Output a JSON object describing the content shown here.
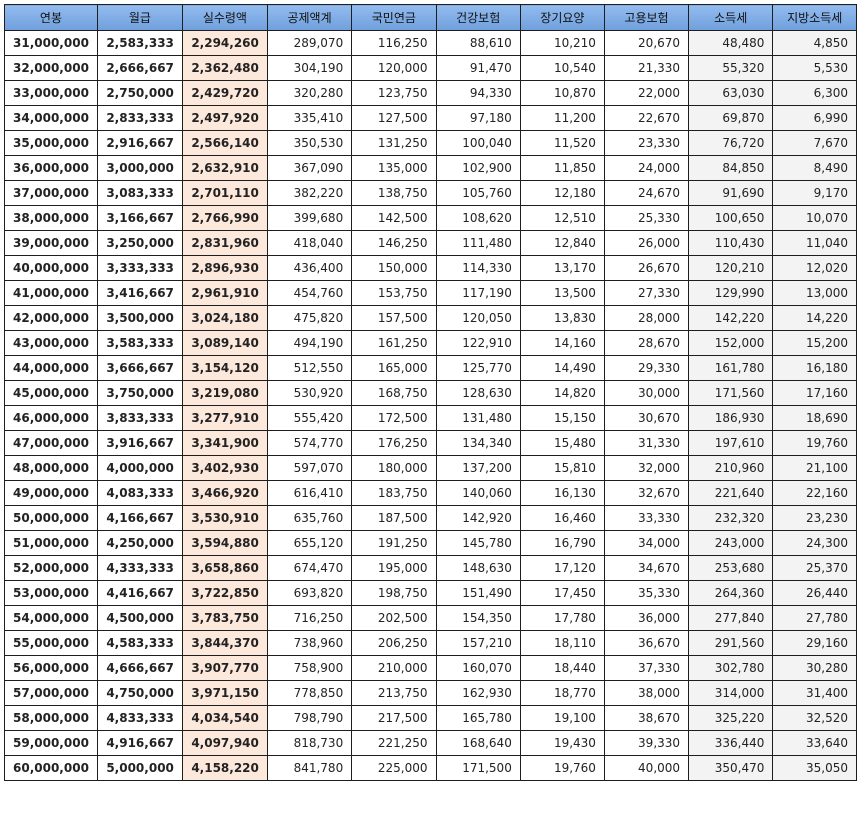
{
  "table": {
    "headers": [
      "연봉",
      "월급",
      "실수령액",
      "공제액계",
      "국민연금",
      "건강보험",
      "장기요양",
      "고용보험",
      "소득세",
      "지방소득세"
    ],
    "rows": [
      [
        "31,000,000",
        "2,583,333",
        "2,294,260",
        "289,070",
        "116,250",
        "88,610",
        "10,210",
        "20,670",
        "48,480",
        "4,850"
      ],
      [
        "32,000,000",
        "2,666,667",
        "2,362,480",
        "304,190",
        "120,000",
        "91,470",
        "10,540",
        "21,330",
        "55,320",
        "5,530"
      ],
      [
        "33,000,000",
        "2,750,000",
        "2,429,720",
        "320,280",
        "123,750",
        "94,330",
        "10,870",
        "22,000",
        "63,030",
        "6,300"
      ],
      [
        "34,000,000",
        "2,833,333",
        "2,497,920",
        "335,410",
        "127,500",
        "97,180",
        "11,200",
        "22,670",
        "69,870",
        "6,990"
      ],
      [
        "35,000,000",
        "2,916,667",
        "2,566,140",
        "350,530",
        "131,250",
        "100,040",
        "11,520",
        "23,330",
        "76,720",
        "7,670"
      ],
      [
        "36,000,000",
        "3,000,000",
        "2,632,910",
        "367,090",
        "135,000",
        "102,900",
        "11,850",
        "24,000",
        "84,850",
        "8,490"
      ],
      [
        "37,000,000",
        "3,083,333",
        "2,701,110",
        "382,220",
        "138,750",
        "105,760",
        "12,180",
        "24,670",
        "91,690",
        "9,170"
      ],
      [
        "38,000,000",
        "3,166,667",
        "2,766,990",
        "399,680",
        "142,500",
        "108,620",
        "12,510",
        "25,330",
        "100,650",
        "10,070"
      ],
      [
        "39,000,000",
        "3,250,000",
        "2,831,960",
        "418,040",
        "146,250",
        "111,480",
        "12,840",
        "26,000",
        "110,430",
        "11,040"
      ],
      [
        "40,000,000",
        "3,333,333",
        "2,896,930",
        "436,400",
        "150,000",
        "114,330",
        "13,170",
        "26,670",
        "120,210",
        "12,020"
      ],
      [
        "41,000,000",
        "3,416,667",
        "2,961,910",
        "454,760",
        "153,750",
        "117,190",
        "13,500",
        "27,330",
        "129,990",
        "13,000"
      ],
      [
        "42,000,000",
        "3,500,000",
        "3,024,180",
        "475,820",
        "157,500",
        "120,050",
        "13,830",
        "28,000",
        "142,220",
        "14,220"
      ],
      [
        "43,000,000",
        "3,583,333",
        "3,089,140",
        "494,190",
        "161,250",
        "122,910",
        "14,160",
        "28,670",
        "152,000",
        "15,200"
      ],
      [
        "44,000,000",
        "3,666,667",
        "3,154,120",
        "512,550",
        "165,000",
        "125,770",
        "14,490",
        "29,330",
        "161,780",
        "16,180"
      ],
      [
        "45,000,000",
        "3,750,000",
        "3,219,080",
        "530,920",
        "168,750",
        "128,630",
        "14,820",
        "30,000",
        "171,560",
        "17,160"
      ],
      [
        "46,000,000",
        "3,833,333",
        "3,277,910",
        "555,420",
        "172,500",
        "131,480",
        "15,150",
        "30,670",
        "186,930",
        "18,690"
      ],
      [
        "47,000,000",
        "3,916,667",
        "3,341,900",
        "574,770",
        "176,250",
        "134,340",
        "15,480",
        "31,330",
        "197,610",
        "19,760"
      ],
      [
        "48,000,000",
        "4,000,000",
        "3,402,930",
        "597,070",
        "180,000",
        "137,200",
        "15,810",
        "32,000",
        "210,960",
        "21,100"
      ],
      [
        "49,000,000",
        "4,083,333",
        "3,466,920",
        "616,410",
        "183,750",
        "140,060",
        "16,130",
        "32,670",
        "221,640",
        "22,160"
      ],
      [
        "50,000,000",
        "4,166,667",
        "3,530,910",
        "635,760",
        "187,500",
        "142,920",
        "16,460",
        "33,330",
        "232,320",
        "23,230"
      ],
      [
        "51,000,000",
        "4,250,000",
        "3,594,880",
        "655,120",
        "191,250",
        "145,780",
        "16,790",
        "34,000",
        "243,000",
        "24,300"
      ],
      [
        "52,000,000",
        "4,333,333",
        "3,658,860",
        "674,470",
        "195,000",
        "148,630",
        "17,120",
        "34,670",
        "253,680",
        "25,370"
      ],
      [
        "53,000,000",
        "4,416,667",
        "3,722,850",
        "693,820",
        "198,750",
        "151,490",
        "17,450",
        "35,330",
        "264,360",
        "26,440"
      ],
      [
        "54,000,000",
        "4,500,000",
        "3,783,750",
        "716,250",
        "202,500",
        "154,350",
        "17,780",
        "36,000",
        "277,840",
        "27,780"
      ],
      [
        "55,000,000",
        "4,583,333",
        "3,844,370",
        "738,960",
        "206,250",
        "157,210",
        "18,110",
        "36,670",
        "291,560",
        "29,160"
      ],
      [
        "56,000,000",
        "4,666,667",
        "3,907,770",
        "758,900",
        "210,000",
        "160,070",
        "18,440",
        "37,330",
        "302,780",
        "30,280"
      ],
      [
        "57,000,000",
        "4,750,000",
        "3,971,150",
        "778,850",
        "213,750",
        "162,930",
        "18,770",
        "38,000",
        "314,000",
        "31,400"
      ],
      [
        "58,000,000",
        "4,833,333",
        "4,034,540",
        "798,790",
        "217,500",
        "165,780",
        "19,100",
        "38,670",
        "325,220",
        "32,520"
      ],
      [
        "59,000,000",
        "4,916,667",
        "4,097,940",
        "818,730",
        "221,250",
        "168,640",
        "19,430",
        "39,330",
        "336,440",
        "33,640"
      ],
      [
        "60,000,000",
        "5,000,000",
        "4,158,220",
        "841,780",
        "225,000",
        "171,500",
        "19,760",
        "40,000",
        "350,470",
        "35,050"
      ]
    ]
  },
  "colors": {
    "header_bg": "#7fa9e6",
    "net_column_bg": "#fde8dc",
    "tax_column_bg": "#f3f3f3",
    "border": "#1e1e1e"
  }
}
